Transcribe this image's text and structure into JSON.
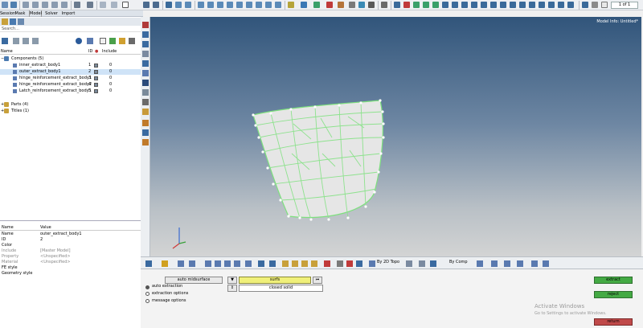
{
  "tabs": [
    "Session",
    "Mask",
    "Model",
    "Solver",
    "Import"
  ],
  "page_counter": "1 of 1",
  "model_info": "Model Info: Untitled*",
  "search_placeholder": "Search...",
  "tree_header": {
    "name": "Name",
    "id": "ID",
    "color": "●",
    "include": "Include"
  },
  "tree": {
    "components_label": "Components (5)",
    "components": [
      {
        "name": "inner_extract_body1",
        "id": "1",
        "include": "0",
        "color": "#7a8a9a"
      },
      {
        "name": "outer_extract_body1",
        "id": "2",
        "include": "0",
        "color": "#7a8a9a",
        "selected": true
      },
      {
        "name": "hinge_reinforcement_extract_body1",
        "id": "3",
        "include": "0",
        "color": "#7a8a9a"
      },
      {
        "name": "hinge_reinforcement_extract_body2",
        "id": "4",
        "include": "0",
        "color": "#7a8a9a"
      },
      {
        "name": "Latch_reinforcement_extract_body1",
        "id": "5",
        "include": "0",
        "color": "#7a8a9a"
      }
    ],
    "parts_label": "Parts (4)",
    "titles_label": "Titles (1)"
  },
  "props_header": {
    "name": "Name",
    "value": "Value"
  },
  "props": [
    {
      "name": "Name",
      "value": "outer_extract_body1"
    },
    {
      "name": "ID",
      "value": "2"
    },
    {
      "name": "Color",
      "value": ""
    },
    {
      "name": "Include",
      "value": "[Master Model]",
      "dim": true
    },
    {
      "name": "Property",
      "value": "<Unspecified>",
      "dim": true
    },
    {
      "name": "Material",
      "value": "<Unspecified>",
      "dim": true
    },
    {
      "name": "FE style",
      "value": ""
    },
    {
      "name": "Geometry style",
      "value": ""
    }
  ],
  "bottom_toolbar": {
    "by_topo": "By 2D Topo",
    "by_comp": "By Comp"
  },
  "panel": {
    "auto_midsurface": "auto midsurface",
    "surfs": "surfs",
    "closed_solid": "closed solid",
    "options": [
      "auto extraction",
      "extraction options",
      "message options"
    ],
    "extract": "extract",
    "reject": "reject",
    "return": "return"
  },
  "activate": {
    "title": "Activate Windows",
    "subtitle": "Go to Settings to activate Windows."
  },
  "colors": {
    "viewport_top": "#31557b",
    "mesh_edge": "#7ee07e",
    "accent_green": "#44aa44",
    "return_red": "#c04a4a",
    "surfs_yellow": "#f0f07a"
  }
}
